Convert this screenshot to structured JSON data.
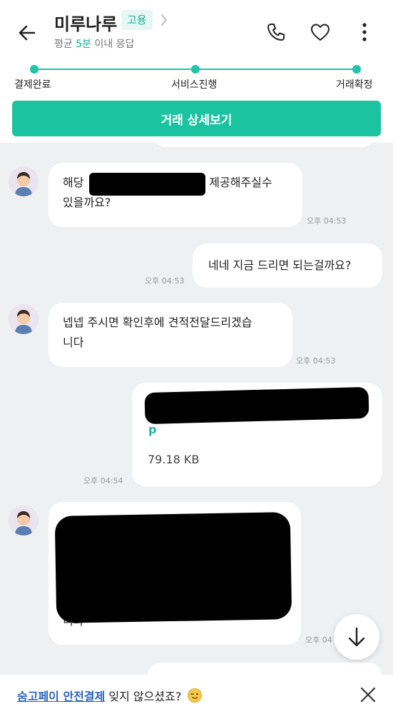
{
  "header": {
    "title": "미루나루",
    "badge": "고용",
    "response_prefix": "평균",
    "response_highlight": "5분",
    "response_suffix": "이내 응답"
  },
  "progress": {
    "steps": [
      {
        "label": "결제완료"
      },
      {
        "label": "서비스진행"
      },
      {
        "label": "거래확정"
      }
    ]
  },
  "detail_button": "거래 상세보기",
  "messages": [
    {
      "sender": "other",
      "text_before": "해당",
      "text_after": "도 제공해주실수",
      "line2": "있을까요?",
      "time": "오후 04:53"
    },
    {
      "sender": "me",
      "text": "네네 지금 드리면 되는걸까요?",
      "time": "오후 04:53"
    },
    {
      "sender": "other",
      "line1": "넵넵 주시면 확인후에 견적전달드리겠습",
      "line2": "니다",
      "time": "오후 04:53"
    },
    {
      "sender": "me",
      "file_name": "p",
      "file_size": "79.18 KB",
      "time": "오후 04:54"
    },
    {
      "sender": "other",
      "last_line": "니다",
      "time": "오후 04"
    }
  ],
  "banner": {
    "link": "숨고페이 안전결제",
    "text": " 잊지 않으셨죠?"
  },
  "icons": {
    "back": "back-arrow-icon",
    "phone": "phone-icon",
    "heart": "heart-icon",
    "more": "more-vertical-icon",
    "scroll": "arrow-down-icon",
    "close": "close-icon"
  },
  "colors": {
    "accent": "#1bc3a1",
    "link": "#2a63c4",
    "background": "#eef0f2"
  }
}
